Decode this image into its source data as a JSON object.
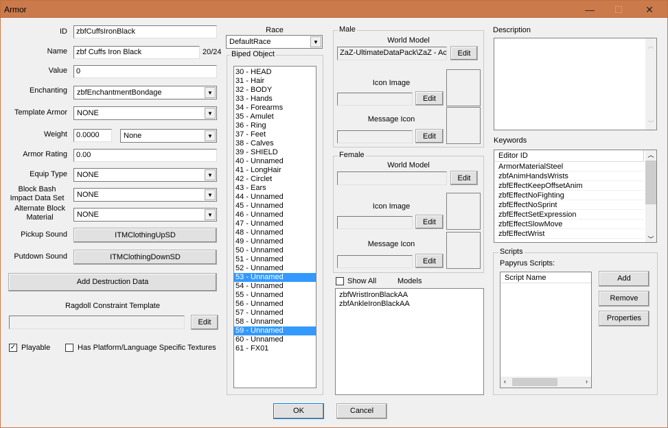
{
  "window": {
    "title": "Armor",
    "minimize": "—",
    "maximize": "☐",
    "close": "✕"
  },
  "left": {
    "id_label": "ID",
    "id": "zbfCuffsIronBlack",
    "name_label": "Name",
    "name": "zbf Cuffs Iron Black",
    "name_count": "20/24",
    "value_label": "Value",
    "value": "0",
    "enchanting_label": "Enchanting",
    "enchanting": "zbfEnchantmentBondage",
    "template_label": "Template Armor",
    "template": "NONE",
    "weight_label": "Weight",
    "weight": "0.0000",
    "weight_type": "None",
    "rating_label": "Armor Rating",
    "rating": "0.00",
    "equip_label": "Equip Type",
    "equip": "NONE",
    "bash_label": "Block Bash Impact Data Set",
    "bash": "NONE",
    "altblock_label": "Alternate Block Material",
    "altblock": "NONE",
    "pickup_label": "Pickup Sound",
    "pickup": "ITMClothingUpSD",
    "putdown_label": "Putdown Sound",
    "putdown": "ITMClothingDownSD",
    "add_destruction": "Add Destruction Data",
    "ragdoll_label": "Ragdoll Constraint Template",
    "ragdoll_edit": "Edit",
    "playable_label": "Playable",
    "playable": true,
    "platform_label": "Has Platform/Language Specific Textures",
    "platform": false
  },
  "race": {
    "label": "Race",
    "value": "DefaultRace"
  },
  "biped": {
    "label": "Biped Object",
    "items": [
      "30 - HEAD",
      "31 - Hair",
      "32 - BODY",
      "33 - Hands",
      "34 - Forearms",
      "35 - Amulet",
      "36 - Ring",
      "37 - Feet",
      "38 - Calves",
      "39 - SHIELD",
      "40 - Unnamed",
      "41 - LongHair",
      "42 - Circlet",
      "43 - Ears",
      "44 - Unnamed",
      "45 - Unnamed",
      "46 - Unnamed",
      "47 - Unnamed",
      "48 - Unnamed",
      "49 - Unnamed",
      "50 - Unnamed",
      "51 - Unnamed",
      "52 - Unnamed",
      "53 - Unnamed",
      "54 - Unnamed",
      "55 - Unnamed",
      "56 - Unnamed",
      "57 - Unnamed",
      "58 - Unnamed",
      "59 - Unnamed",
      "60 - Unnamed",
      "61 - FX01"
    ],
    "selected": [
      "53 - Unnamed",
      "59 - Unnamed"
    ]
  },
  "male": {
    "label": "Male",
    "world_model": "World Model",
    "world_model_path": "ZaZ-UltimateDataPack\\ZaZ - Ac",
    "icon_image": "Icon Image",
    "message_icon": "Message Icon",
    "edit": "Edit"
  },
  "female": {
    "label": "Female",
    "world_model": "World Model",
    "icon_image": "Icon Image",
    "message_icon": "Message Icon",
    "edit": "Edit"
  },
  "models": {
    "show_all": "Show All",
    "show_all_checked": false,
    "label": "Models",
    "items": [
      "zbfWristIronBlackAA",
      "zbfAnkleIronBlackAA"
    ]
  },
  "description": {
    "label": "Description",
    "value": ""
  },
  "keywords": {
    "label": "Keywords",
    "column": "Editor ID",
    "items": [
      "ArmorMaterialSteel",
      "zbfAnimHandsWrists",
      "zbfEffectKeepOffsetAnim",
      "zbfEffectNoFighting",
      "zbfEffectNoSprint",
      "zbfEffectSetExpression",
      "zbfEffectSlowMove",
      "zbfEffectWrist"
    ]
  },
  "scripts": {
    "label": "Scripts",
    "papyrus": "Papyrus Scripts:",
    "column": "Script Name",
    "add": "Add",
    "remove": "Remove",
    "properties": "Properties"
  },
  "footer": {
    "ok": "OK",
    "cancel": "Cancel"
  }
}
